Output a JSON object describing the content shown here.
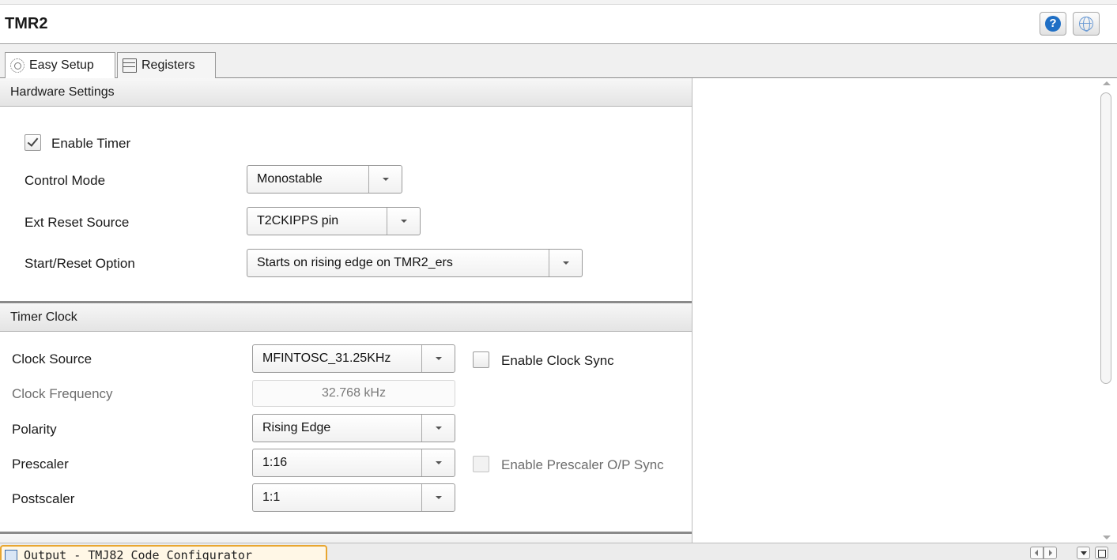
{
  "window": {
    "title": "TMR2"
  },
  "tabs": [
    {
      "label": "Easy Setup",
      "icon": "gear-icon",
      "selected": true
    },
    {
      "label": "Registers",
      "icon": "registers-icon",
      "selected": false
    }
  ],
  "hardware": {
    "header": "Hardware Settings",
    "enable_timer": {
      "label": "Enable Timer",
      "checked": true
    },
    "control_mode": {
      "label": "Control Mode",
      "value": "Monostable"
    },
    "ext_reset_source": {
      "label": "Ext Reset Source",
      "value": "T2CKIPPS pin"
    },
    "start_reset_option": {
      "label": "Start/Reset Option",
      "value": "Starts on rising edge on TMR2_ers"
    }
  },
  "timer_clock": {
    "header": "Timer Clock",
    "clock_source": {
      "label": "Clock Source",
      "value": "MFINTOSC_31.25KHz"
    },
    "enable_clock_sync": {
      "label": "Enable Clock Sync",
      "checked": false
    },
    "clock_frequency": {
      "label": "Clock Frequency",
      "value": "32.768 kHz"
    },
    "polarity": {
      "label": "Polarity",
      "value": "Rising Edge"
    },
    "prescaler": {
      "label": "Prescaler",
      "value": "1:16"
    },
    "enable_prescaler_sync": {
      "label": "Enable Prescaler O/P Sync",
      "checked": false,
      "disabled": true
    },
    "postscaler": {
      "label": "Postscaler",
      "value": "1:1"
    }
  },
  "bottom_tab": {
    "label": "Output - TMJ82 Code Configurator"
  },
  "colors": {
    "accent_tab_border": "#e8a630",
    "help_blue": "#1f6fc5"
  }
}
